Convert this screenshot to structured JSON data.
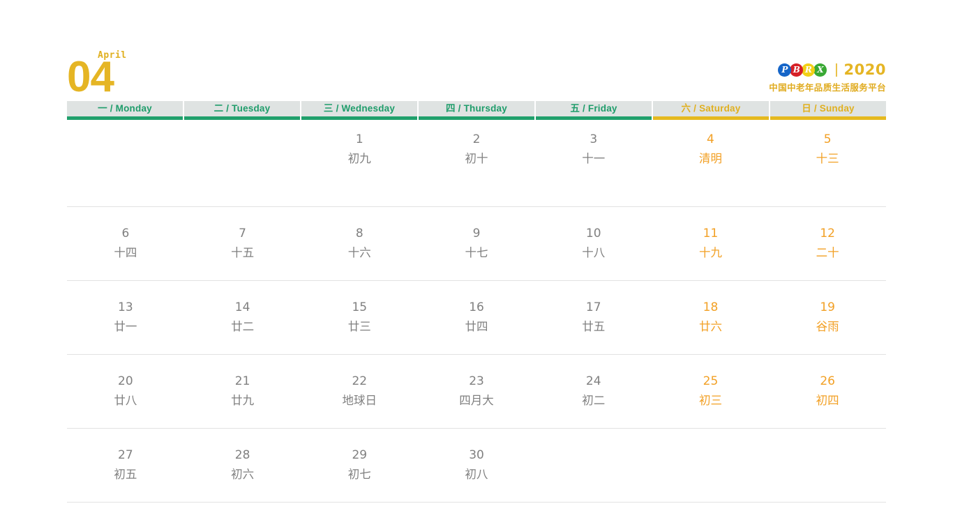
{
  "header": {
    "month_number": "04",
    "month_name": "April",
    "brand": {
      "logo_letters": [
        {
          "letter": "P",
          "color": "#1565c8"
        },
        {
          "letter": "B",
          "color": "#d62027"
        },
        {
          "letter": "R",
          "color": "#f2d017"
        },
        {
          "letter": "X",
          "color": "#3aa935"
        }
      ],
      "separator": "|",
      "year": "2020",
      "tagline": "中国中老年品质生活服务平台"
    }
  },
  "weekdays": [
    {
      "label": "一 / Monday",
      "weekend": false
    },
    {
      "label": "二 / Tuesday",
      "weekend": false
    },
    {
      "label": "三 / Wednesday",
      "weekend": false
    },
    {
      "label": "四 / Thursday",
      "weekend": false
    },
    {
      "label": "五 / Friday",
      "weekend": false
    },
    {
      "label": "六 / Saturday",
      "weekend": true
    },
    {
      "label": "日 / Sunday",
      "weekend": true
    }
  ],
  "colors": {
    "accent_gold": "#e5b524",
    "accent_green": "#20a06c",
    "weekend_orange": "#f2a025",
    "weekday_gray": "#808080",
    "header_bg": "#dfe3e2"
  },
  "weeks": [
    [
      {
        "day": "",
        "lunar": "",
        "weekend": false,
        "empty": true
      },
      {
        "day": "",
        "lunar": "",
        "weekend": false,
        "empty": true
      },
      {
        "day": "1",
        "lunar": "初九",
        "weekend": false,
        "empty": false
      },
      {
        "day": "2",
        "lunar": "初十",
        "weekend": false,
        "empty": false
      },
      {
        "day": "3",
        "lunar": "十一",
        "weekend": false,
        "empty": false
      },
      {
        "day": "4",
        "lunar": "清明",
        "weekend": true,
        "empty": false
      },
      {
        "day": "5",
        "lunar": "十三",
        "weekend": true,
        "empty": false
      }
    ],
    [
      {
        "day": "6",
        "lunar": "十四",
        "weekend": false,
        "empty": false
      },
      {
        "day": "7",
        "lunar": "十五",
        "weekend": false,
        "empty": false
      },
      {
        "day": "8",
        "lunar": "十六",
        "weekend": false,
        "empty": false
      },
      {
        "day": "9",
        "lunar": "十七",
        "weekend": false,
        "empty": false
      },
      {
        "day": "10",
        "lunar": "十八",
        "weekend": false,
        "empty": false
      },
      {
        "day": "11",
        "lunar": "十九",
        "weekend": true,
        "empty": false
      },
      {
        "day": "12",
        "lunar": "二十",
        "weekend": true,
        "empty": false
      }
    ],
    [
      {
        "day": "13",
        "lunar": "廿一",
        "weekend": false,
        "empty": false
      },
      {
        "day": "14",
        "lunar": "廿二",
        "weekend": false,
        "empty": false
      },
      {
        "day": "15",
        "lunar": "廿三",
        "weekend": false,
        "empty": false
      },
      {
        "day": "16",
        "lunar": "廿四",
        "weekend": false,
        "empty": false
      },
      {
        "day": "17",
        "lunar": "廿五",
        "weekend": false,
        "empty": false
      },
      {
        "day": "18",
        "lunar": "廿六",
        "weekend": true,
        "empty": false
      },
      {
        "day": "19",
        "lunar": "谷雨",
        "weekend": true,
        "empty": false
      }
    ],
    [
      {
        "day": "20",
        "lunar": "廿八",
        "weekend": false,
        "empty": false
      },
      {
        "day": "21",
        "lunar": "廿九",
        "weekend": false,
        "empty": false
      },
      {
        "day": "22",
        "lunar": "地球日",
        "weekend": false,
        "empty": false
      },
      {
        "day": "23",
        "lunar": "四月大",
        "weekend": false,
        "empty": false
      },
      {
        "day": "24",
        "lunar": "初二",
        "weekend": false,
        "empty": false
      },
      {
        "day": "25",
        "lunar": "初三",
        "weekend": true,
        "empty": false
      },
      {
        "day": "26",
        "lunar": "初四",
        "weekend": true,
        "empty": false
      }
    ],
    [
      {
        "day": "27",
        "lunar": "初五",
        "weekend": false,
        "empty": false
      },
      {
        "day": "28",
        "lunar": "初六",
        "weekend": false,
        "empty": false
      },
      {
        "day": "29",
        "lunar": "初七",
        "weekend": false,
        "empty": false
      },
      {
        "day": "30",
        "lunar": "初八",
        "weekend": false,
        "empty": false
      },
      {
        "day": "",
        "lunar": "",
        "weekend": false,
        "empty": true
      },
      {
        "day": "",
        "lunar": "",
        "weekend": true,
        "empty": true
      },
      {
        "day": "",
        "lunar": "",
        "weekend": true,
        "empty": true
      }
    ]
  ]
}
